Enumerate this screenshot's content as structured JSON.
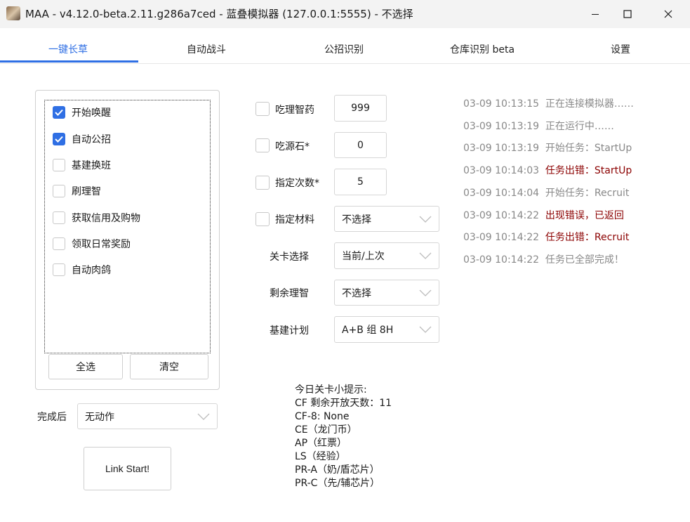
{
  "window": {
    "title": "MAA - v4.12.0-beta.2.11.g286a7ced - 蓝叠模拟器 (127.0.0.1:5555) - 不选择"
  },
  "tabs": [
    {
      "label": "一键长草",
      "active": true
    },
    {
      "label": "自动战斗",
      "active": false
    },
    {
      "label": "公招识别",
      "active": false
    },
    {
      "label": "仓库识别 beta",
      "active": false
    },
    {
      "label": "设置",
      "active": false
    }
  ],
  "tasks": [
    {
      "label": "开始唤醒",
      "checked": true
    },
    {
      "label": "自动公招",
      "checked": true
    },
    {
      "label": "基建换班",
      "checked": false
    },
    {
      "label": "刷理智",
      "checked": false
    },
    {
      "label": "获取信用及购物",
      "checked": false
    },
    {
      "label": "领取日常奖励",
      "checked": false
    },
    {
      "label": "自动肉鸽",
      "checked": false
    }
  ],
  "task_buttons": {
    "select_all": "全选",
    "clear": "清空"
  },
  "after_complete": {
    "label": "完成后",
    "value": "无动作"
  },
  "link_start": "Link Start!",
  "options": {
    "sanity_potion": {
      "label": "吃理智药",
      "checked": false,
      "value": "999"
    },
    "originium": {
      "label": "吃源石*",
      "checked": false,
      "value": "0"
    },
    "times": {
      "label": "指定次数*",
      "checked": false,
      "value": "5"
    },
    "material": {
      "label": "指定材料",
      "checked": false,
      "value": "不选择"
    },
    "stage": {
      "label": "关卡选择",
      "value": "当前/上次"
    },
    "remaining_sanity": {
      "label": "剩余理智",
      "value": "不选择"
    },
    "infrast_plan": {
      "label": "基建计划",
      "value": "A+B 组 8H"
    }
  },
  "tips": {
    "title": "今日关卡小提示:",
    "lines": [
      "CF 剩余开放天数：11",
      "CF-8: None",
      "CE（龙门币）",
      "AP（红票）",
      "LS（经验）",
      "PR-A（奶/盾芯片）",
      "PR-C（先/辅芯片）"
    ]
  },
  "log": [
    {
      "time": "03-09  10:13:15",
      "msg": "正在连接模拟器……",
      "level": "info"
    },
    {
      "time": "03-09  10:13:19",
      "msg": "正在运行中……",
      "level": "info"
    },
    {
      "time": "03-09  10:13:19",
      "msg": "开始任务：StartUp",
      "level": "info"
    },
    {
      "time": "03-09  10:14:03",
      "msg": "任务出错：StartUp",
      "level": "error"
    },
    {
      "time": "03-09  10:14:04",
      "msg": "开始任务：Recruit",
      "level": "info"
    },
    {
      "time": "03-09  10:14:22",
      "msg": "出现错误，已返回",
      "level": "error"
    },
    {
      "time": "03-09  10:14:22",
      "msg": "任务出错：Recruit",
      "level": "error"
    },
    {
      "time": "03-09  10:14:22",
      "msg": "任务已全部完成！",
      "level": "info"
    }
  ],
  "colors": {
    "accent": "#2f6fe4",
    "error": "#8b0000",
    "log_info": "#888888"
  }
}
